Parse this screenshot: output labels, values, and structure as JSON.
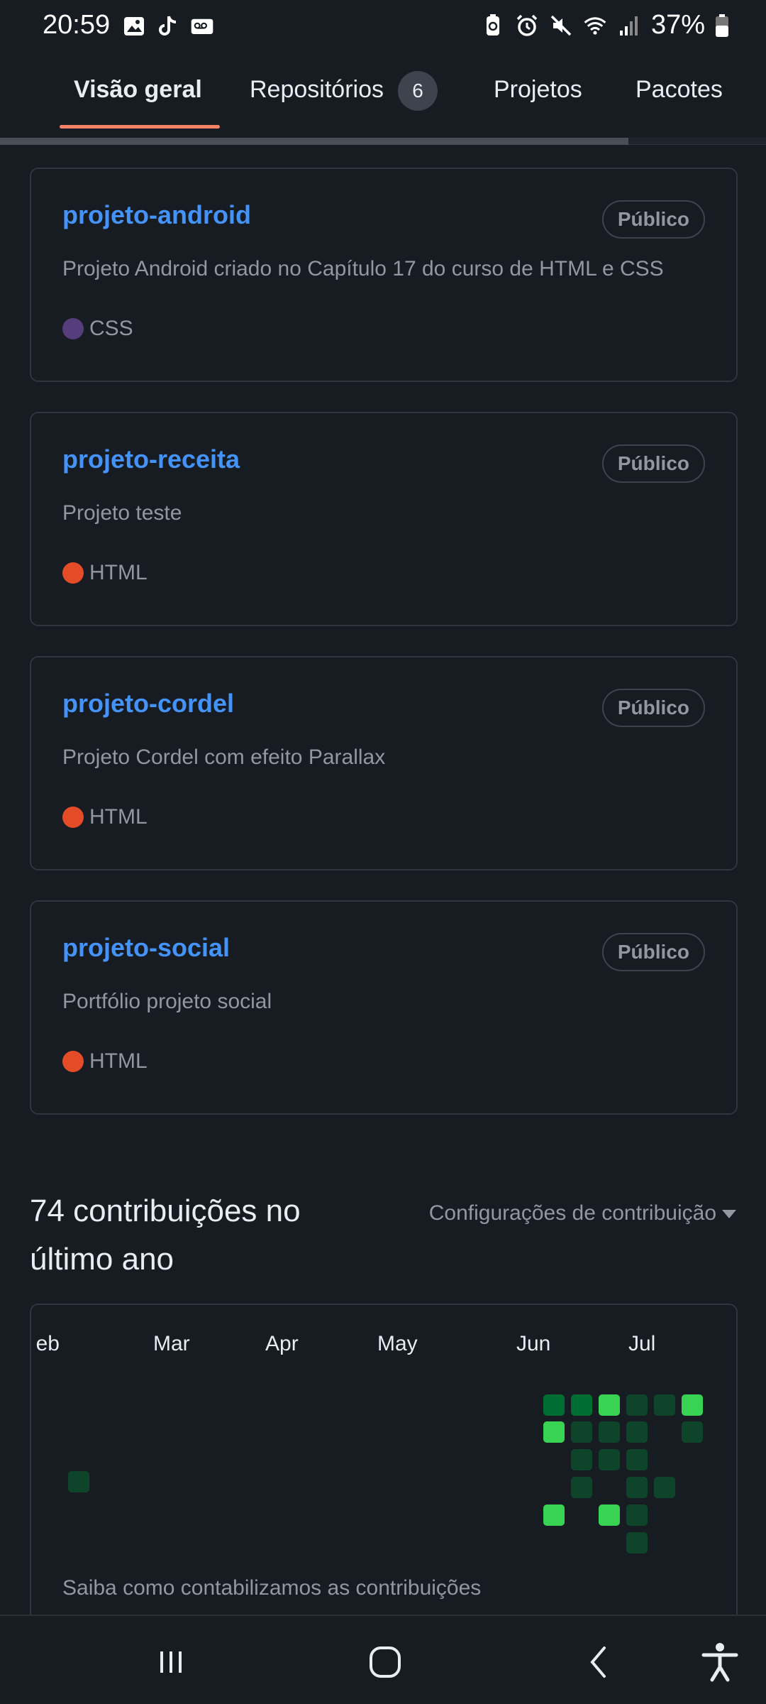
{
  "status_bar": {
    "time": "20:59",
    "battery_pct": "37%",
    "left_icons": [
      "gallery-icon",
      "tiktok-icon",
      "voicemail-icon"
    ],
    "right_icons": [
      "battery-saver-icon",
      "alarm-icon",
      "mute-icon",
      "wifi-icon",
      "signal-icon",
      "battery-icon"
    ]
  },
  "tabs": [
    {
      "label": "Visão geral",
      "active": true
    },
    {
      "label": "Repositórios",
      "count": "6"
    },
    {
      "label": "Projetos"
    },
    {
      "label": "Pacotes"
    }
  ],
  "repos": [
    {
      "name": "projeto-android",
      "visibility": "Público",
      "description": "Projeto Android criado no Capítulo 17 do curso de HTML e CSS",
      "language": "CSS",
      "lang_color": "#563d7c"
    },
    {
      "name": "projeto-receita",
      "visibility": "Público",
      "description": "Projeto teste",
      "language": "HTML",
      "lang_color": "#e34c26"
    },
    {
      "name": "projeto-cordel",
      "visibility": "Público",
      "description": "Projeto Cordel com efeito Parallax",
      "language": "HTML",
      "lang_color": "#e34c26"
    },
    {
      "name": "projeto-social",
      "visibility": "Público",
      "description": "Portfólio projeto social",
      "language": "HTML",
      "lang_color": "#e34c26"
    }
  ],
  "contributions": {
    "title": "74 contribuições no último ano",
    "settings_label": "Configurações de contribuição",
    "months": [
      "eb",
      "Mar",
      "Apr",
      "May",
      "Jun",
      "Jul"
    ],
    "learn_link": "Saiba como contabilizamos as contribuições",
    "level_colors": {
      "1": "#0e4429",
      "2": "#006d32",
      "3": "#26a641",
      "4": "#39d353"
    }
  },
  "nav": {
    "buttons": [
      "recent-apps-icon",
      "home-icon",
      "back-icon",
      "accessibility-icon"
    ]
  }
}
